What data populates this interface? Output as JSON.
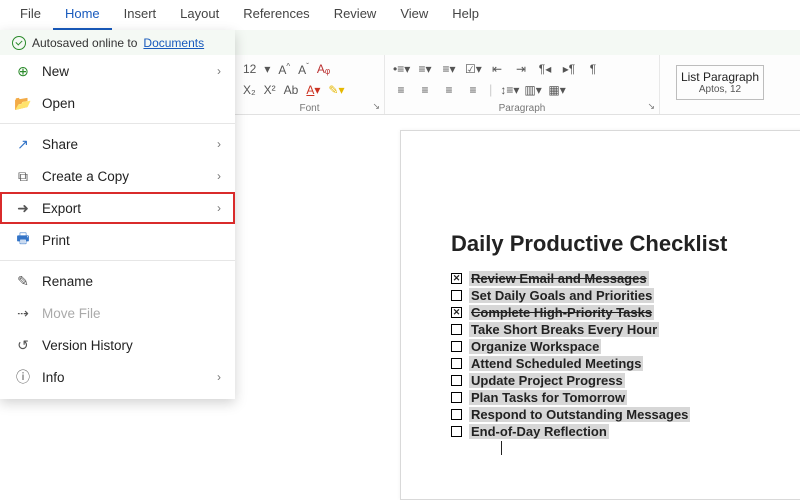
{
  "menubar": [
    "File",
    "Home",
    "Insert",
    "Layout",
    "References",
    "Review",
    "View",
    "Help"
  ],
  "menubar_active_index": 1,
  "autosave": {
    "prefix": "Autosaved online to",
    "location": "Documents"
  },
  "font_group": {
    "size": "12",
    "label": "Font"
  },
  "paragraph_group": {
    "label": "Paragraph"
  },
  "style_box": {
    "name": "List Paragraph",
    "sub": "Aptos, 12"
  },
  "file_menu": [
    {
      "icon": "plus",
      "label": "New",
      "chevron": true,
      "color": "#2a8a2a"
    },
    {
      "icon": "folder",
      "label": "Open",
      "chevron": false,
      "color": "#d79a2b"
    },
    {
      "sep": true
    },
    {
      "icon": "share",
      "label": "Share",
      "chevron": true,
      "color": "#3374c7"
    },
    {
      "icon": "copy",
      "label": "Create a Copy",
      "chevron": true
    },
    {
      "icon": "export",
      "label": "Export",
      "chevron": true,
      "highlight": true
    },
    {
      "icon": "print",
      "label": "Print",
      "chevron": false,
      "color": "#3374c7"
    },
    {
      "sep": true
    },
    {
      "icon": "rename",
      "label": "Rename",
      "chevron": false
    },
    {
      "icon": "move",
      "label": "Move File",
      "chevron": false,
      "muted": true
    },
    {
      "icon": "history",
      "label": "Version History",
      "chevron": false
    },
    {
      "icon": "info",
      "label": "Info",
      "chevron": true
    }
  ],
  "document": {
    "title": "Daily Productive Checklist",
    "items": [
      {
        "done": true,
        "text": "Review Email and Messages"
      },
      {
        "done": false,
        "text": "Set Daily Goals and Priorities"
      },
      {
        "done": true,
        "text": "Complete High-Priority Tasks"
      },
      {
        "done": false,
        "text": "Take Short Breaks Every Hour"
      },
      {
        "done": false,
        "text": "Organize Workspace"
      },
      {
        "done": false,
        "text": "Attend Scheduled Meetings"
      },
      {
        "done": false,
        "text": "Update Project Progress"
      },
      {
        "done": false,
        "text": " Plan Tasks for Tomorrow"
      },
      {
        "done": false,
        "text": "Respond to Outstanding Messages"
      },
      {
        "done": false,
        "text": "End-of-Day Reflection"
      }
    ]
  }
}
